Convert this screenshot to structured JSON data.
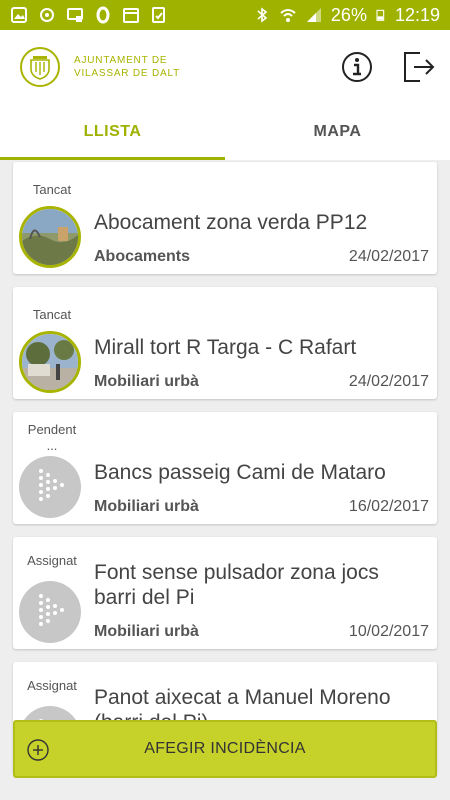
{
  "statusbar": {
    "battery": "26%",
    "time": "12:19"
  },
  "header": {
    "org_line1": "Ajuntament de",
    "org_line2": "Vilassar de Dalt",
    "info_icon": "info-icon",
    "logout_icon": "logout-icon"
  },
  "tabs": [
    {
      "label": "LLISTA",
      "active": true
    },
    {
      "label": "MAPA",
      "active": false
    }
  ],
  "incidents": [
    {
      "status": "Tancat",
      "title": "Abocament zona verda PP12",
      "category": "Abocaments",
      "date": "24/02/2017",
      "thumb": "photo"
    },
    {
      "status": "Tancat",
      "title": "Mirall tort R Targa - C Rafart",
      "category": "Mobiliari urbà",
      "date": "24/02/2017",
      "thumb": "photo"
    },
    {
      "status": "Pendent ...",
      "title": "Bancs passeig Cami de Mataro",
      "category": "Mobiliari urbà",
      "date": "16/02/2017",
      "thumb": "placeholder"
    },
    {
      "status": "Assignat",
      "title": "Font sense pulsador zona jocs barri del Pi",
      "category": "Mobiliari urbà",
      "date": "10/02/2017",
      "thumb": "placeholder"
    },
    {
      "status": "Assignat",
      "title": "Panot aixecat a Manuel Moreno (barri del Pi)",
      "category": "",
      "date": "",
      "thumb": "placeholder"
    }
  ],
  "add_button": {
    "label": "AFEGIR INCIDÈNCIA",
    "icon": "plus-circle-icon"
  },
  "colors": {
    "accent": "#9fb200",
    "button": "#c6d12a"
  }
}
